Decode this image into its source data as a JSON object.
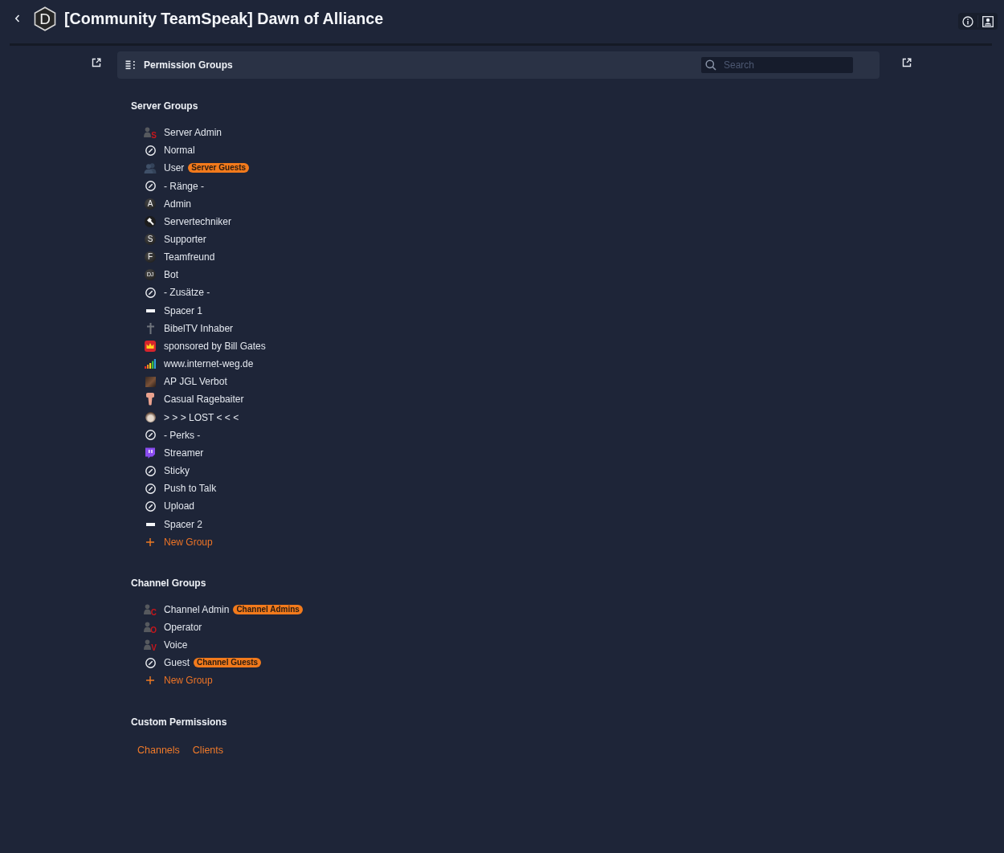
{
  "header": {
    "logo_letter": "D",
    "title": "[Community TeamSpeak] Dawn of Alliance"
  },
  "toolbar": {
    "title": "Permission Groups",
    "search": {
      "placeholder": "Search"
    }
  },
  "sections": [
    {
      "kind": "groups",
      "title": "Server Groups",
      "items": [
        {
          "kind": "person-letter",
          "letter": "S",
          "name": "Server Admin"
        },
        {
          "kind": "blocked",
          "name": "Normal"
        },
        {
          "kind": "users",
          "name": "User",
          "badge": "Server Guests"
        },
        {
          "kind": "blocked",
          "name": "- Ränge -"
        },
        {
          "kind": "letter-disc",
          "letter": "A",
          "name": "Admin"
        },
        {
          "kind": "hammer",
          "name": "Servertechniker"
        },
        {
          "kind": "letter-disc",
          "letter": "S",
          "name": "Supporter"
        },
        {
          "kind": "letter-disc",
          "letter": "F",
          "name": "Teamfreund"
        },
        {
          "kind": "letter-disc",
          "letter": "DJ",
          "name": "Bot"
        },
        {
          "kind": "blocked",
          "name": "- Zusätze -"
        },
        {
          "kind": "dash",
          "name": "Spacer 1"
        },
        {
          "kind": "cross",
          "name": "BibelTV Inhaber"
        },
        {
          "kind": "crown",
          "name": "sponsored by Bill Gates"
        },
        {
          "kind": "signal-bars",
          "name": "www.internet-weg.de"
        },
        {
          "kind": "picture",
          "name": "AP JGL Verbot"
        },
        {
          "kind": "t-shape",
          "name": "Casual Ragebaiter"
        },
        {
          "kind": "avatar",
          "name": "> > > LOST < < <"
        },
        {
          "kind": "blocked",
          "name": "- Perks -"
        },
        {
          "kind": "chat-bubble",
          "name": "Streamer"
        },
        {
          "kind": "blocked",
          "name": "Sticky"
        },
        {
          "kind": "blocked",
          "name": "Push to Talk"
        },
        {
          "kind": "blocked",
          "name": "Upload"
        },
        {
          "kind": "dash",
          "name": "Spacer 2"
        }
      ],
      "add_label": "New Group"
    },
    {
      "kind": "groups",
      "title": "Channel Groups",
      "items": [
        {
          "kind": "person-letter",
          "letter": "C",
          "name": "Channel Admin",
          "badge": "Channel Admins"
        },
        {
          "kind": "person-letter",
          "letter": "O",
          "name": "Operator"
        },
        {
          "kind": "person-letter",
          "letter": "V",
          "name": "Voice"
        },
        {
          "kind": "blocked",
          "name": "Guest",
          "badge": "Channel Guests"
        }
      ],
      "add_label": "New Group"
    },
    {
      "kind": "links",
      "title": "Custom Permissions",
      "links": [
        "Channels",
        "Clients"
      ]
    }
  ]
}
